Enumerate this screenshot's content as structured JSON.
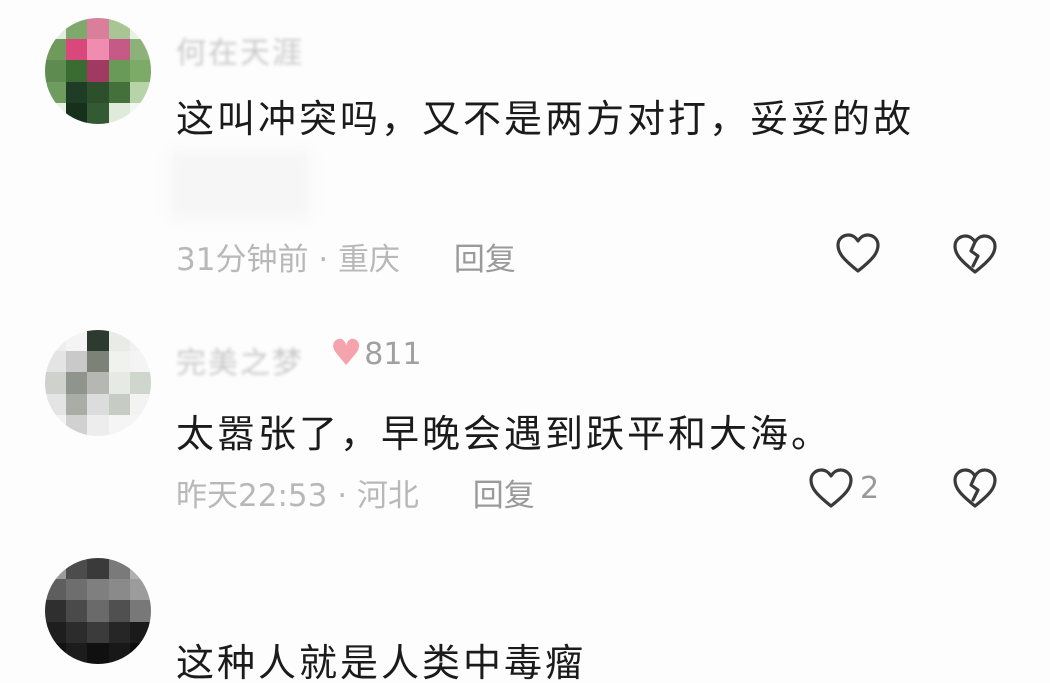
{
  "comments": [
    {
      "username": "何在天涯",
      "text": "这叫冲突吗，又不是两方对打，妥妥的故",
      "time": "31分钟前",
      "location": "重庆",
      "reply_label": "回复",
      "likes": "",
      "avatar_colors": [
        "#e3ece1",
        "#7fa86c",
        "#d97f9c",
        "#a8c694",
        "#e8efe5",
        "#6f9a5c",
        "#d9477d",
        "#f08cb0",
        "#c65a87",
        "#8cb279",
        "#5e8b4f",
        "#3a6b30",
        "#a03a62",
        "#6a9a58",
        "#7bab67",
        "#6e9c5e",
        "#1f3d24",
        "#2e4f2c",
        "#44703b",
        "#b9d3a8",
        "#e9f1e4",
        "#17301b",
        "#345a33",
        "#dfeada",
        "#f3f7f1"
      ]
    },
    {
      "username": "完美之梦",
      "fans": "811",
      "text": "太嚣张了，早晚会遇到跃平和大海。",
      "time": "昨天22:53",
      "location": "河北",
      "reply_label": "回复",
      "likes": "2",
      "avatar_colors": [
        "#eeeeee",
        "#f4f4f4",
        "#2d3a2f",
        "#e9ece6",
        "#f1f1f1",
        "#e4e4e4",
        "#c9c9c9",
        "#7c8278",
        "#f0f2ee",
        "#f4f4f4",
        "#cfd2cc",
        "#8f948c",
        "#b5b8b2",
        "#e7eae4",
        "#cfd6cb",
        "#e4e4e4",
        "#a9ada6",
        "#dcdcdc",
        "#c6cbc3",
        "#f3f3f3",
        "#f3f3f3",
        "#d1d1d1",
        "#ededed",
        "#f5f5f5",
        "#f5f5f5"
      ]
    },
    {
      "username": "",
      "text": "这种人就是人类中毒瘤",
      "avatar_colors": [
        "#9b9b9b",
        "#4c4c4c",
        "#3a3a3a",
        "#7a7a7a",
        "#b0b0b0",
        "#5e5e5e",
        "#6e6e6e",
        "#7f7f7f",
        "#8a8a8a",
        "#9c9c9c",
        "#2f2f2f",
        "#4a4a4a",
        "#6a6a6a",
        "#505050",
        "#787878",
        "#1e1e1e",
        "#2c2c2c",
        "#3b3b3b",
        "#262626",
        "#1a1a1a",
        "#121212",
        "#1c1c1c",
        "#101010",
        "#181818",
        "#0c0c0c"
      ]
    }
  ]
}
